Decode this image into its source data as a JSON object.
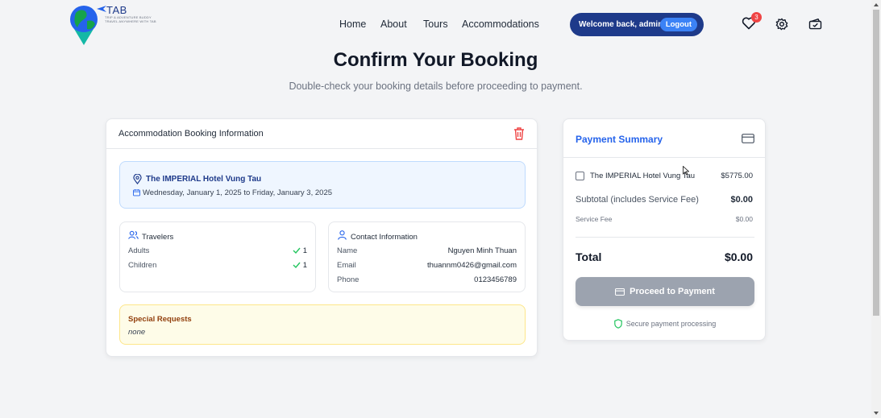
{
  "brand": {
    "name": "TAB",
    "tagline1": "TRIP & ADVENTURE BUDDY",
    "tagline2": "TRAVEL ANYWHERE WITH TAB"
  },
  "nav": {
    "items": [
      "Home",
      "About",
      "Tours",
      "Accommodations"
    ]
  },
  "user": {
    "welcome": "Welcome back, admin1",
    "logout": "Logout"
  },
  "header_icons": {
    "favorites_count": "3",
    "favorites_icon": "heart-icon",
    "settings_icon": "gear-icon",
    "bookings_icon": "ticket-icon"
  },
  "page": {
    "title": "Confirm Your Booking",
    "subtitle": "Double-check your booking details before proceeding to payment."
  },
  "booking": {
    "section_title": "Accommodation Booking Information",
    "hotel_name": "The IMPERIAL Hotel Vung Tau",
    "dates": "Wednesday, January 1, 2025 to Friday, January 3, 2025",
    "travelers": {
      "title": "Travelers",
      "adults_label": "Adults",
      "adults_value": "1",
      "children_label": "Children",
      "children_value": "1"
    },
    "contact": {
      "title": "Contact Information",
      "name_label": "Name",
      "name_value": "Nguyen Minh Thuan",
      "email_label": "Email",
      "email_value": "thuannm0426@gmail.com",
      "phone_label": "Phone",
      "phone_value": "0123456789"
    },
    "special_requests": {
      "title": "Special Requests",
      "value": "none"
    }
  },
  "payment": {
    "title": "Payment Summary",
    "item_name": "The IMPERIAL Hotel Vung Tau",
    "item_price": "$5775.00",
    "item_checked": false,
    "subtotal_label": "Subtotal (includes Service Fee)",
    "subtotal_value": "$0.00",
    "fee_label": "Service Fee",
    "fee_value": "$0.00",
    "total_label": "Total",
    "total_value": "$0.00",
    "proceed_label": "Proceed to Payment",
    "secure_label": "Secure payment processing"
  },
  "colors": {
    "primary": "#1e3a8a",
    "accent": "#2563eb",
    "danger": "#ef4444",
    "success": "#22c55e",
    "disabled": "#9ca3af"
  }
}
